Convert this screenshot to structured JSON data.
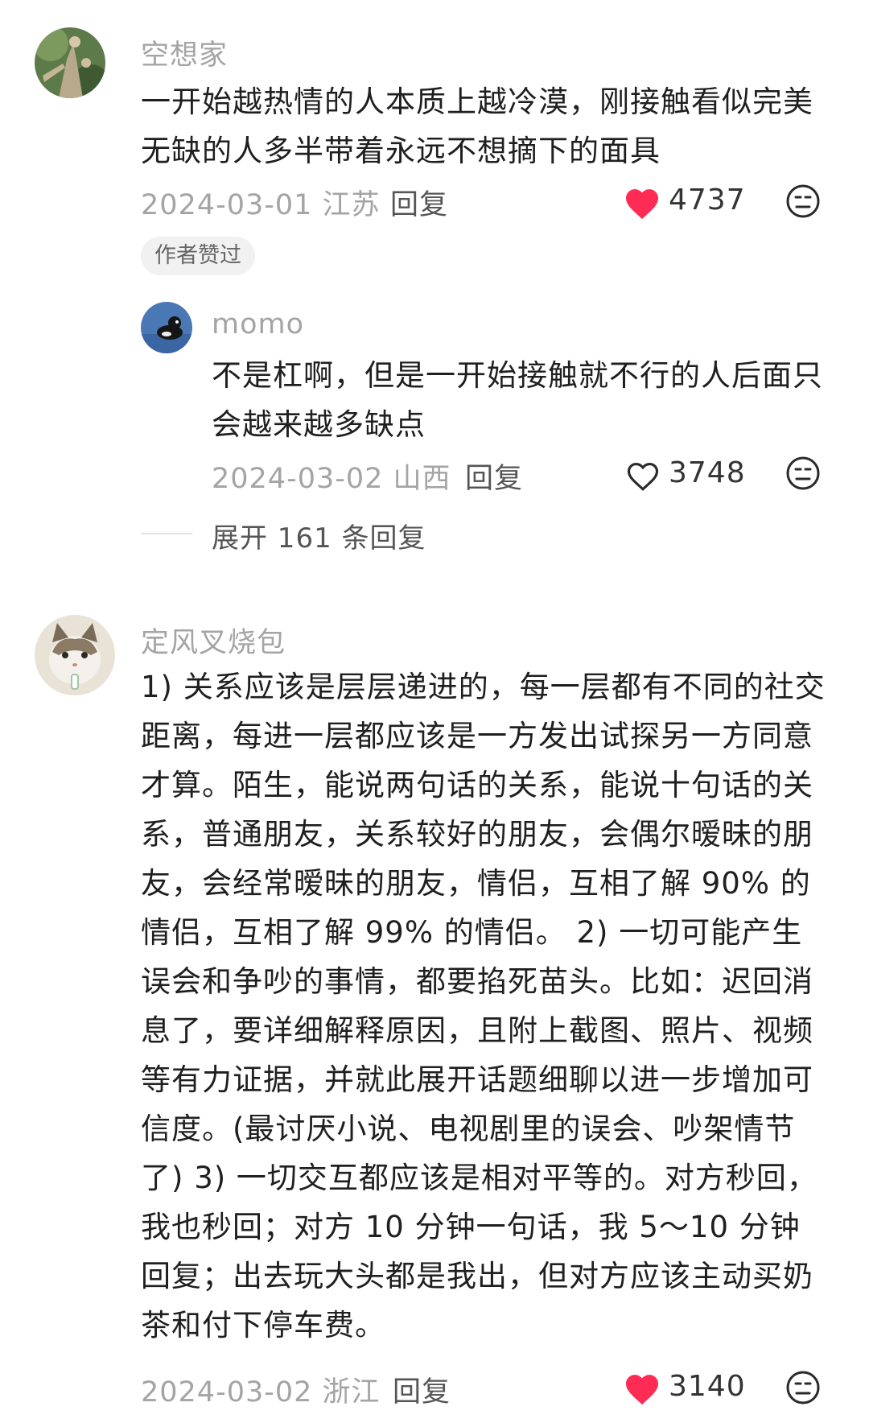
{
  "comments": [
    {
      "username": "空想家",
      "text": "一开始越热情的人本质上越冷漠，刚接触看似完美无缺的人多半带着永远不想摘下的面具",
      "date_location": "2024-03-01 江苏",
      "reply_label": "回复",
      "likes": "4737",
      "liked": true,
      "badge": "作者赞过"
    },
    {
      "username": "定风叉烧包",
      "text": "1) 关系应该是层层递进的，每一层都有不同的社交距离，每进一层都应该是一方发出试探另一方同意才算。陌生，能说两句话的关系，能说十句话的关系，普通朋友，关系较好的朋友，会偶尔暧昧的朋友，会经常暧昧的朋友，情侣，互相了解 90% 的情侣，互相了解 99% 的情侣。 2) 一切可能产生误会和争吵的事情，都要掐死苗头。比如：迟回消息了，要详细解释原因，且附上截图、照片、视频等有力证据，并就此展开话题细聊以进一步增加可信度。(最讨厌小说、电视剧里的误会、吵架情节了) 3) 一切交互都应该是相对平等的。对方秒回，我也秒回；对方 10 分钟一句话，我 5～10 分钟回复；出去玩大头都是我出，但对方应该主动买奶茶和付下停车费。",
      "date_location": "2024-03-02 浙江",
      "reply_label": "回复",
      "likes": "3140",
      "liked": true
    }
  ],
  "reply": {
    "username": "momo",
    "text": "不是杠啊，但是一开始接触就不行的人后面只会越来越多缺点",
    "date_location": "2024-03-02 山西",
    "reply_label": "回复",
    "likes": "3748",
    "liked": false
  },
  "expand": {
    "label": "展开 161 条回复"
  },
  "icons": {
    "heart_filled": "heart-filled-icon",
    "heart_outline": "heart-outline-icon",
    "dislike": "dislike-face-icon"
  },
  "colors": {
    "heart": "#fe2c55",
    "username": "#a4a4a4",
    "text": "#1f1f1f"
  }
}
